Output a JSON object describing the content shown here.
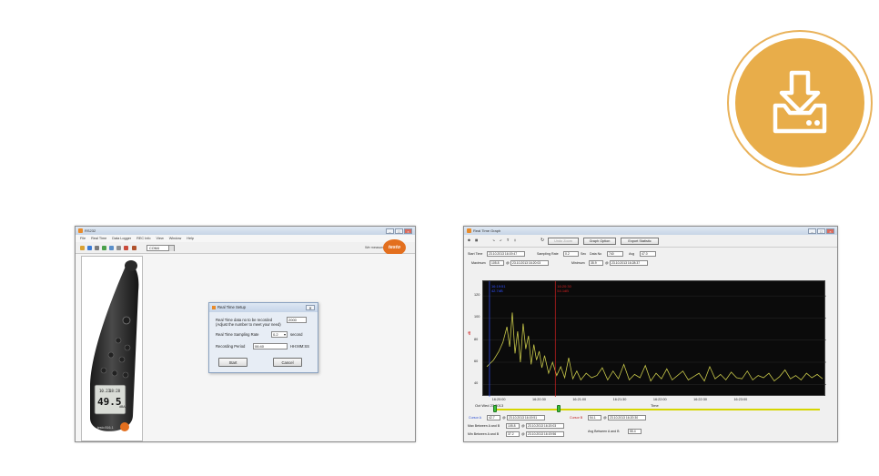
{
  "badge": {
    "icon": "download-icon",
    "color": "#e8ad4a"
  },
  "window1": {
    "title": "RS232",
    "menu": [
      "File",
      "Real Time",
      "Data Logger",
      "REC Info",
      "View",
      "Window",
      "Help"
    ],
    "port": "COM4",
    "tagline": "We measure it.",
    "logo_text": "testo",
    "meter": {
      "reading": "49.5",
      "unit": "dBA",
      "date": "10.23",
      "time": "18:28",
      "model": "testo 816-1"
    },
    "dialog": {
      "title": "Real Time Setup",
      "records_label": "Real Time data no to be recorded",
      "records_hint": "(Adjust the number to meet your need)",
      "records_value": "2000",
      "rate_label": "Real Time Sampling Rate",
      "rate_value": "0.2",
      "rate_unit": "second",
      "period_label": "Recording Period",
      "period_value": "06:40",
      "period_unit": "HH:MM:SS",
      "start": "Start",
      "cancel": "Cancel"
    }
  },
  "window2": {
    "title": "Real Time Graph",
    "buttons": {
      "undo_zoom": "Undo Zoom",
      "graph_option": "Graph Option",
      "export_statistic": "Export Statistic"
    },
    "stats": {
      "start_time_label": "Start Time",
      "start_time": "23.10.2013 16:19:47",
      "sampling_rate_label": "Sampling Rate",
      "sampling_rate": "0.2",
      "sec_label": "Sec",
      "data_no_label": "Data No",
      "data_no": "740",
      "avg_label": "Avg",
      "avg": "47.0",
      "maximum_label": "Maximum",
      "maximum": "105.8",
      "max_time": "23.10.2013 16:20:03",
      "minimum_label": "Minimum",
      "minimum": "35.9",
      "min_time": "23.10.2013 16:28:37"
    },
    "cursor_a_label": "Cursor A",
    "cursor_a_value": "42.7",
    "cursor_a_time": "23.10.2013 16:19:51",
    "cursor_b_label": "Cursor B",
    "cursor_b_value": "54.1",
    "cursor_b_time": "23.10.2013 16:20:30",
    "max_ab_label": "Max Between A and B",
    "max_ab_value": "105.8",
    "max_ab_time": "23.10.2013 16:20:03",
    "min_ab_label": "Min Between A and B",
    "min_ab_value": "37.2",
    "min_ab_time": "23.10.2013 16:19:56",
    "avg_ab_label": "Avg Between A and B",
    "avg_ab_value": "55.4",
    "date_label": "Oct Wed 23 2013",
    "colors": {
      "plot_bg": "#0b0b0b",
      "trace": "#c8c84a",
      "cursor_b": "#d02020",
      "cursor_a": "#3050ff"
    }
  },
  "chart_data": {
    "type": "line",
    "xlabel": "Time",
    "ylabel": "dB",
    "yticks": [
      40,
      60,
      80,
      100,
      120
    ],
    "xticks": [
      "16:20:00",
      "16:20:30",
      "16:21:00",
      "16:21:30",
      "16:22:00",
      "16:22:30",
      "16:23:00"
    ],
    "ylim": [
      32,
      130
    ],
    "xlim_seconds": [
      0,
      250
    ],
    "cursor_a_label": "16:19:51\n42.7dB",
    "cursor_b_label": "16:20:30\n54.1dB",
    "series": [
      {
        "x": [
          0,
          5,
          9,
          12,
          15,
          17,
          19,
          21,
          23,
          25,
          27,
          29,
          31,
          33,
          35,
          37,
          39,
          41,
          43,
          46,
          49,
          52,
          55,
          58,
          61,
          64,
          67,
          70,
          74,
          78,
          82,
          86,
          90,
          94,
          98,
          102,
          106,
          110,
          114,
          118,
          122,
          126,
          130,
          134,
          138,
          142,
          146,
          150,
          154,
          158,
          162,
          166,
          170,
          174,
          178,
          182,
          186,
          190,
          194,
          198,
          202,
          206,
          210,
          214,
          218,
          222,
          226,
          230,
          234,
          238,
          242,
          246,
          250
        ],
        "values": [
          56,
          62,
          70,
          78,
          92,
          74,
          105,
          68,
          88,
          60,
          95,
          72,
          84,
          58,
          76,
          62,
          70,
          55,
          66,
          50,
          60,
          48,
          56,
          46,
          64,
          45,
          52,
          44,
          50,
          46,
          48,
          55,
          44,
          52,
          45,
          58,
          44,
          49,
          46,
          57,
          43,
          50,
          45,
          54,
          44,
          48,
          52,
          44,
          47,
          50,
          43,
          56,
          45,
          49,
          44,
          51,
          46,
          45,
          52,
          44,
          48,
          46,
          50,
          43,
          47,
          53,
          45,
          48,
          44,
          50,
          46,
          49,
          45
        ]
      }
    ]
  }
}
